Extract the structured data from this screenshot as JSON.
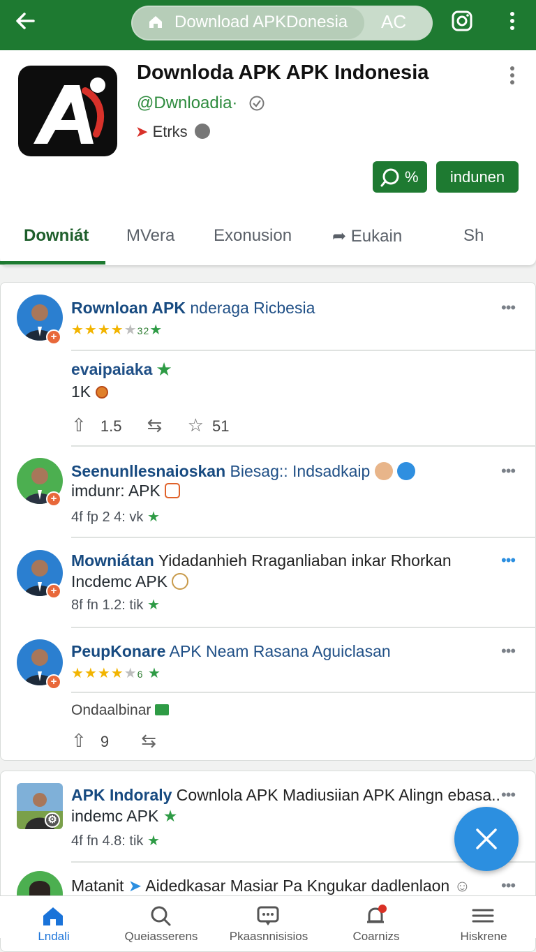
{
  "topbar": {
    "url_text": "Download APKDonesia",
    "url_extra": "AC"
  },
  "app": {
    "title": "Downloda APK APK Indonesia",
    "handle": "@Dwnloadia·",
    "developer": "Etrks",
    "share_label": "%",
    "install_label": "indunen"
  },
  "tabs": [
    {
      "label": "Downiát"
    },
    {
      "label": "MVera"
    },
    {
      "label": "Exonusion"
    },
    {
      "label": "Eukain"
    },
    {
      "label": "Sh"
    }
  ],
  "posts": [
    {
      "title_bold": "Rownloan APK",
      "title_rest": " nderaga Ricbesia",
      "rating": "32",
      "body_title": "evaipaiaka",
      "body_count": "1K",
      "like_count": "1.5",
      "fav_count": "51"
    },
    {
      "title_bold": "Seenunllesnaioskan",
      "title_rest": " Biesag:: Indsadkaip",
      "line2": "imdunr: APK",
      "meta": "4f fp  2 4: vk"
    },
    {
      "title_bold": "Mowniátan",
      "title_rest": " Yidadanhieh Rraganliaban inkar Rhorkan",
      "line2": "Incdemc APK",
      "meta": "8f fn  1.2: tik"
    },
    {
      "title_bold": "PeupKonare",
      "title_rest": " APK Neam Rasana Aguiclasan",
      "rating": "6",
      "body_text": "Ondaalbinar",
      "like_count": "9"
    },
    {
      "title_bold": "APK Indoraly",
      "title_rest": " Cownlola APK Madiusiian APK Alingn ebasa..",
      "line2": "indemc APK",
      "meta": "4f fn  4.8: tik"
    },
    {
      "title_bold": "Matanit",
      "title_rest": " Aidedkasar Masiar Pa Kngukar dadlenlaon"
    }
  ],
  "bottom_nav": [
    {
      "label": "Lndali"
    },
    {
      "label": "Queiasserens"
    },
    {
      "label": "Pkaasnnisisios"
    },
    {
      "label": "Coarnizs"
    },
    {
      "label": "Hiskrene"
    }
  ],
  "colors": {
    "brand_green": "#1e7a31",
    "link_blue": "#1f4f86",
    "fab_blue": "#2c8fe0",
    "star_gold": "#f2b400"
  }
}
